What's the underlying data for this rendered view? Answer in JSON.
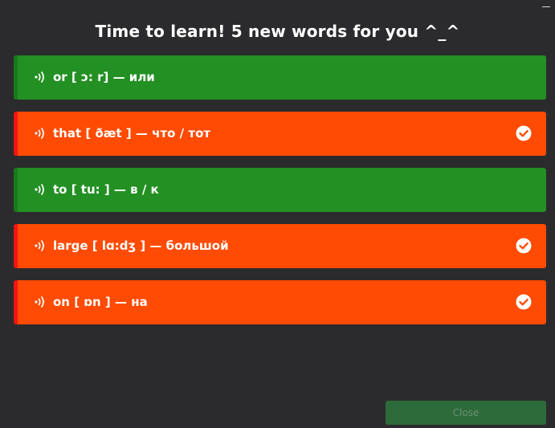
{
  "title": "Time to learn! 5 new words for you ^_^",
  "icons": {
    "minimize": "minimize-icon",
    "sound": "sound-icon",
    "check": "check-icon"
  },
  "colors": {
    "background": "#2b2b2d",
    "known_row": "#239023",
    "new_row": "#ff4b03",
    "close_button": "#2e6b3a"
  },
  "words": [
    {
      "text": "or [ ɔ: r] — или",
      "status": "known",
      "checked": false
    },
    {
      "text": "that [ ðæt ] — что / тот",
      "status": "new",
      "checked": true
    },
    {
      "text": "to [ tu: ] — в / к",
      "status": "known",
      "checked": false
    },
    {
      "text": "large [ lɑ:dʒ ] — большой",
      "status": "new",
      "checked": true
    },
    {
      "text": "on [ ɒn ] — на",
      "status": "new",
      "checked": true
    }
  ],
  "close_label": "Close"
}
